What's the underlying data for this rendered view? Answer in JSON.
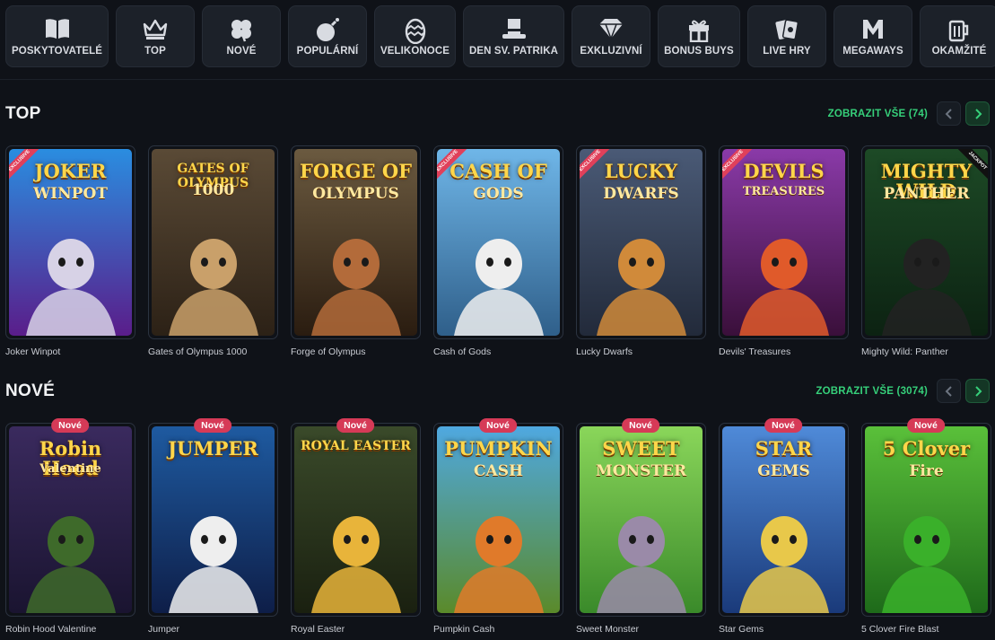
{
  "categories": [
    {
      "label": "POSKYTOVATELÉ",
      "icon": "book-icon"
    },
    {
      "label": "TOP",
      "icon": "crown-icon"
    },
    {
      "label": "NOVÉ",
      "icon": "clover-icon"
    },
    {
      "label": "POPULÁRNÍ",
      "icon": "bomb-icon"
    },
    {
      "label": "VELIKONOCE",
      "icon": "easter-egg-icon"
    },
    {
      "label": "DEN SV. PATRIKA",
      "icon": "leprechaun-hat-icon"
    },
    {
      "label": "EXKLUZIVNÍ",
      "icon": "diamond-icon"
    },
    {
      "label": "BONUS BUYS",
      "icon": "gift-icon"
    },
    {
      "label": "LIVE HRY",
      "icon": "playing-cards-icon"
    },
    {
      "label": "MEGAWAYS",
      "icon": "megaways-m-icon"
    },
    {
      "label": "OKAMŽITÉ",
      "icon": "beer-mug-icon"
    }
  ],
  "sections": {
    "top": {
      "title": "TOP",
      "view_all": "ZOBRAZIT VŠE (74)",
      "games": [
        {
          "name": "Joker Winpot",
          "art_title": "JOKER",
          "art_sub": "WINPOT",
          "flag": "EXCLUSIVE",
          "c1": "#2a8de0",
          "c2": "#5a1d8a",
          "figure": "#d7d2e6"
        },
        {
          "name": "Gates of Olympus 1000",
          "art_title": "GATES OF OLYMPUS",
          "art_sub": "1000",
          "flag": "",
          "c1": "#5a4a36",
          "c2": "#2c2116",
          "figure": "#c9a06a"
        },
        {
          "name": "Forge of Olympus",
          "art_title": "FORGE OF",
          "art_sub": "OLYMPUS",
          "flag": "",
          "c1": "#6b5a40",
          "c2": "#2a1c10",
          "figure": "#b36b3a"
        },
        {
          "name": "Cash of Gods",
          "art_title": "CASH OF",
          "art_sub": "GODS",
          "flag": "EXCLUSIVE",
          "c1": "#6fb6e8",
          "c2": "#2f5f8a",
          "figure": "#eeeeee"
        },
        {
          "name": "Lucky Dwarfs",
          "art_title": "LUCKY",
          "art_sub": "DWARFS",
          "flag": "EXCLUSIVE",
          "c1": "#4a5a76",
          "c2": "#222a3a",
          "figure": "#d08a3a"
        },
        {
          "name": "Devils' Treasures",
          "art_title": "DEVILS",
          "art_sub": "TREASURES",
          "flag": "EXCLUSIVE",
          "c1": "#8a3aa8",
          "c2": "#3a0f3a",
          "figure": "#e05a2a"
        },
        {
          "name": "Mighty Wild: Panther",
          "art_title": "MIGHTY WILD",
          "art_sub": "PANTHER",
          "flag": "JACKPOT",
          "c1": "#1d4a26",
          "c2": "#0c2212",
          "figure": "#222222"
        }
      ]
    },
    "new": {
      "title": "NOVÉ",
      "view_all": "ZOBRAZIT VŠE (3074)",
      "badge": "Nové",
      "games": [
        {
          "name": "Robin Hood Valentine",
          "art_title": "Robin Hood",
          "art_sub": "Valentine",
          "c1": "#3a2a5e",
          "c2": "#1a1430",
          "figure": "#3e6a2a"
        },
        {
          "name": "Jumper",
          "art_title": "JUMPER",
          "art_sub": "",
          "c1": "#1e5aa0",
          "c2": "#0e1e48",
          "figure": "#eeeeee"
        },
        {
          "name": "Royal Easter",
          "art_title": "ROYAL EASTER",
          "art_sub": "",
          "c1": "#3a4a2a",
          "c2": "#1a2010",
          "figure": "#e8b43a"
        },
        {
          "name": "Pumpkin Cash",
          "art_title": "PUMPKIN",
          "art_sub": "CASH",
          "c1": "#4fa8e0",
          "c2": "#5a8a2a",
          "figure": "#e07a2a"
        },
        {
          "name": "Sweet Monster",
          "art_title": "SWEET",
          "art_sub": "MONSTER",
          "c1": "#8ad65a",
          "c2": "#3a8a2a",
          "figure": "#9a8aa8"
        },
        {
          "name": "Star Gems",
          "art_title": "STAR",
          "art_sub": "GEMS",
          "c1": "#4f8ad8",
          "c2": "#1a3a7a",
          "figure": "#e8c84a"
        },
        {
          "name": "5 Clover Fire Blast",
          "art_title": "5 Clover",
          "art_sub": "Fire",
          "c1": "#5ac03a",
          "c2": "#1e6a1a",
          "figure": "#3ab02a"
        }
      ]
    }
  },
  "accent": "#36d07a",
  "badge_color": "#d63a57"
}
